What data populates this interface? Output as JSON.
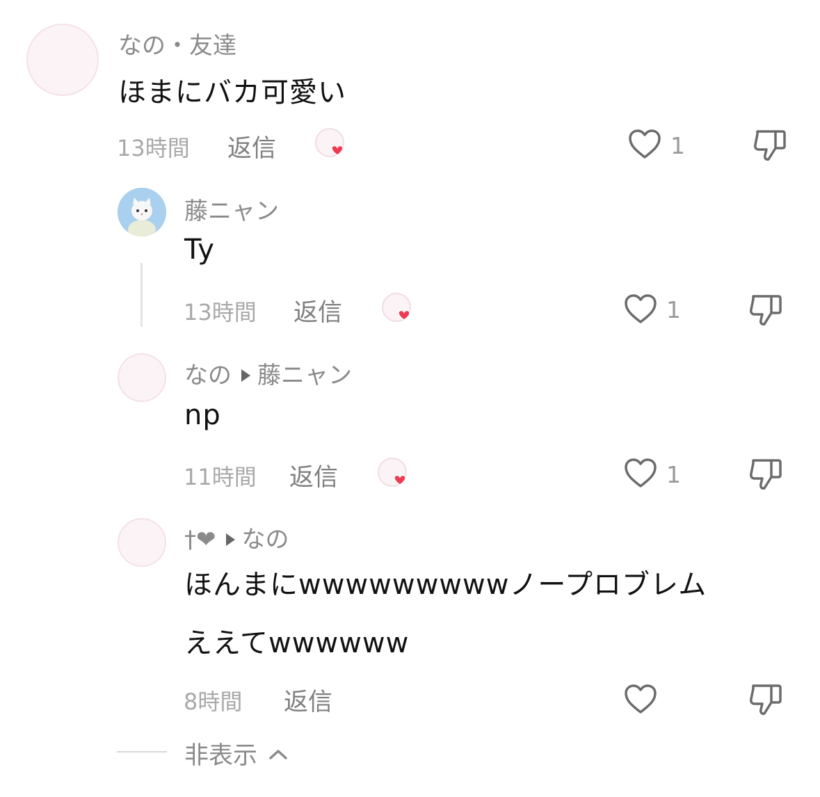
{
  "comments": [
    {
      "username": "なの・友達",
      "text": "ほまにバカ可愛い",
      "time": "13時間",
      "reply_label": "返信",
      "like_count": "1",
      "creator_liked": true
    },
    {
      "username": "藤ニャン",
      "text": "Ty",
      "time": "13時間",
      "reply_label": "返信",
      "like_count": "1",
      "creator_liked": true
    },
    {
      "username": "なの",
      "reply_to": "藤ニャン",
      "text": "np",
      "time": "11時間",
      "reply_label": "返信",
      "like_count": "1",
      "creator_liked": true
    },
    {
      "username": "†❤",
      "reply_to": "なの",
      "text_line1": "ほんまにwwwwwwwwwノープロブレム",
      "text_line2": "ええてwwwwww",
      "time": "8時間",
      "reply_label": "返信",
      "like_count": "",
      "creator_liked": false
    }
  ],
  "hide_label": "非表示",
  "icons": {
    "like": "heart-outline-icon",
    "dislike": "thumbs-down-icon",
    "creator_like": "creator-heart-badge-icon",
    "collapse": "chevron-up-icon"
  },
  "colors": {
    "heart_red": "#ee3b52",
    "muted_text": "#8a8a8a",
    "icon_gray": "#6b6b6b"
  }
}
